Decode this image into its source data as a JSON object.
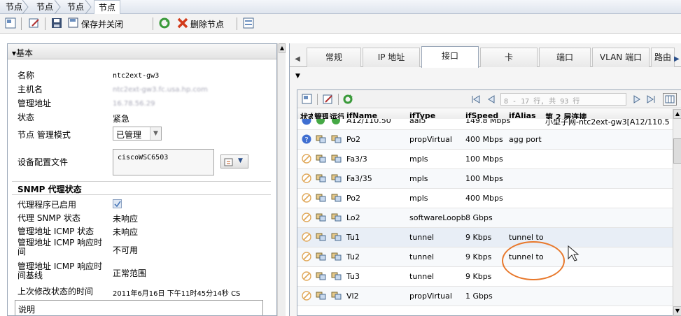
{
  "breadcrumb": [
    "节点",
    "节点",
    "节点",
    "节点"
  ],
  "toolbar": {
    "save_close": "保存并关闭",
    "delete_node": "删除节点"
  },
  "left": {
    "section_basic": "▾基本",
    "fields": {
      "name_label": "名称",
      "name_value": "ntc2ext-gw3",
      "host_label": "主机名",
      "host_value": "ntc2ext-gw3.fc.usa.hp.com",
      "mgmt_label": "管理地址",
      "mgmt_value": "16.78.56.29",
      "status_label": "状态",
      "status_value": "紧急",
      "mode_label": "节点 管理模式",
      "mode_value": "已管理",
      "profile_label": "设备配置文件",
      "profile_value": "ciscoWSC6503"
    },
    "snmp": {
      "title": "SNMP 代理状态",
      "enabled_label": "代理程序已启用",
      "agent_label": "代理 SNMP 状态",
      "agent_value": "未响应",
      "icmp_label": "管理地址 ICMP 状态",
      "icmp_value": "未响应",
      "icmp_resp_label": "管理地址 ICMP 响应时间",
      "icmp_resp_value": "不可用",
      "icmp_base_label": "管理地址 ICMP 响应时间基线",
      "icmp_base_value": "正常范围",
      "lastmod_label": "上次修改状态的时间",
      "lastmod_value": "2011年6月16日 下午11时45分14秒 CS",
      "desc_label": "说明"
    }
  },
  "tabs": [
    "常规",
    "IP 地址",
    "接口",
    "卡",
    "端口",
    "VLAN 端口",
    "路由"
  ],
  "active_tab": "接口",
  "grid": {
    "pager": "8 - 17 行, 共 93 行",
    "headers": [
      "状态",
      "管理",
      "运行",
      "ifName",
      "ifType",
      "ifSpeed",
      "ifAlias",
      "第 2 层连接"
    ],
    "rows": [
      {
        "status": "partial",
        "ifName": "A12/110.50",
        "ifType": "aal5",
        "ifSpeed": "149.8 Mbps",
        "ifAlias": "",
        "l2": "小型子网-ntc2ext-gw3[A12/110.5"
      },
      {
        "status": "unknown",
        "ifName": "Po2",
        "ifType": "propVirtual",
        "ifSpeed": "400 Mbps",
        "ifAlias": "agg port",
        "l2": ""
      },
      {
        "status": "nostatus",
        "ifName": "Fa3/3",
        "ifType": "mpls",
        "ifSpeed": "100 Mbps",
        "ifAlias": "",
        "l2": ""
      },
      {
        "status": "nostatus",
        "ifName": "Fa3/35",
        "ifType": "mpls",
        "ifSpeed": "100 Mbps",
        "ifAlias": "",
        "l2": ""
      },
      {
        "status": "nostatus",
        "ifName": "Po2",
        "ifType": "mpls",
        "ifSpeed": "400 Mbps",
        "ifAlias": "",
        "l2": ""
      },
      {
        "status": "nostatus",
        "ifName": "Lo2",
        "ifType": "softwareLoopb",
        "ifSpeed": "8 Gbps",
        "ifAlias": "",
        "l2": ""
      },
      {
        "status": "nostatus",
        "ifName": "Tu1",
        "ifType": "tunnel",
        "ifSpeed": "9 Kbps",
        "ifAlias": "tunnel to",
        "l2": ""
      },
      {
        "status": "nostatus",
        "ifName": "Tu2",
        "ifType": "tunnel",
        "ifSpeed": "9 Kbps",
        "ifAlias": "tunnel to",
        "l2": ""
      },
      {
        "status": "nostatus",
        "ifName": "Tu3",
        "ifType": "tunnel",
        "ifSpeed": "9 Kbps",
        "ifAlias": "",
        "l2": ""
      },
      {
        "status": "nostatus",
        "ifName": "Vl2",
        "ifType": "propVirtual",
        "ifSpeed": "1 Gbps",
        "ifAlias": "",
        "l2": ""
      }
    ]
  },
  "colors": {
    "accent": "#e8782b",
    "nostatus": "#e0a85a",
    "unknown": "#3f6fd1",
    "normal": "#45a845"
  }
}
